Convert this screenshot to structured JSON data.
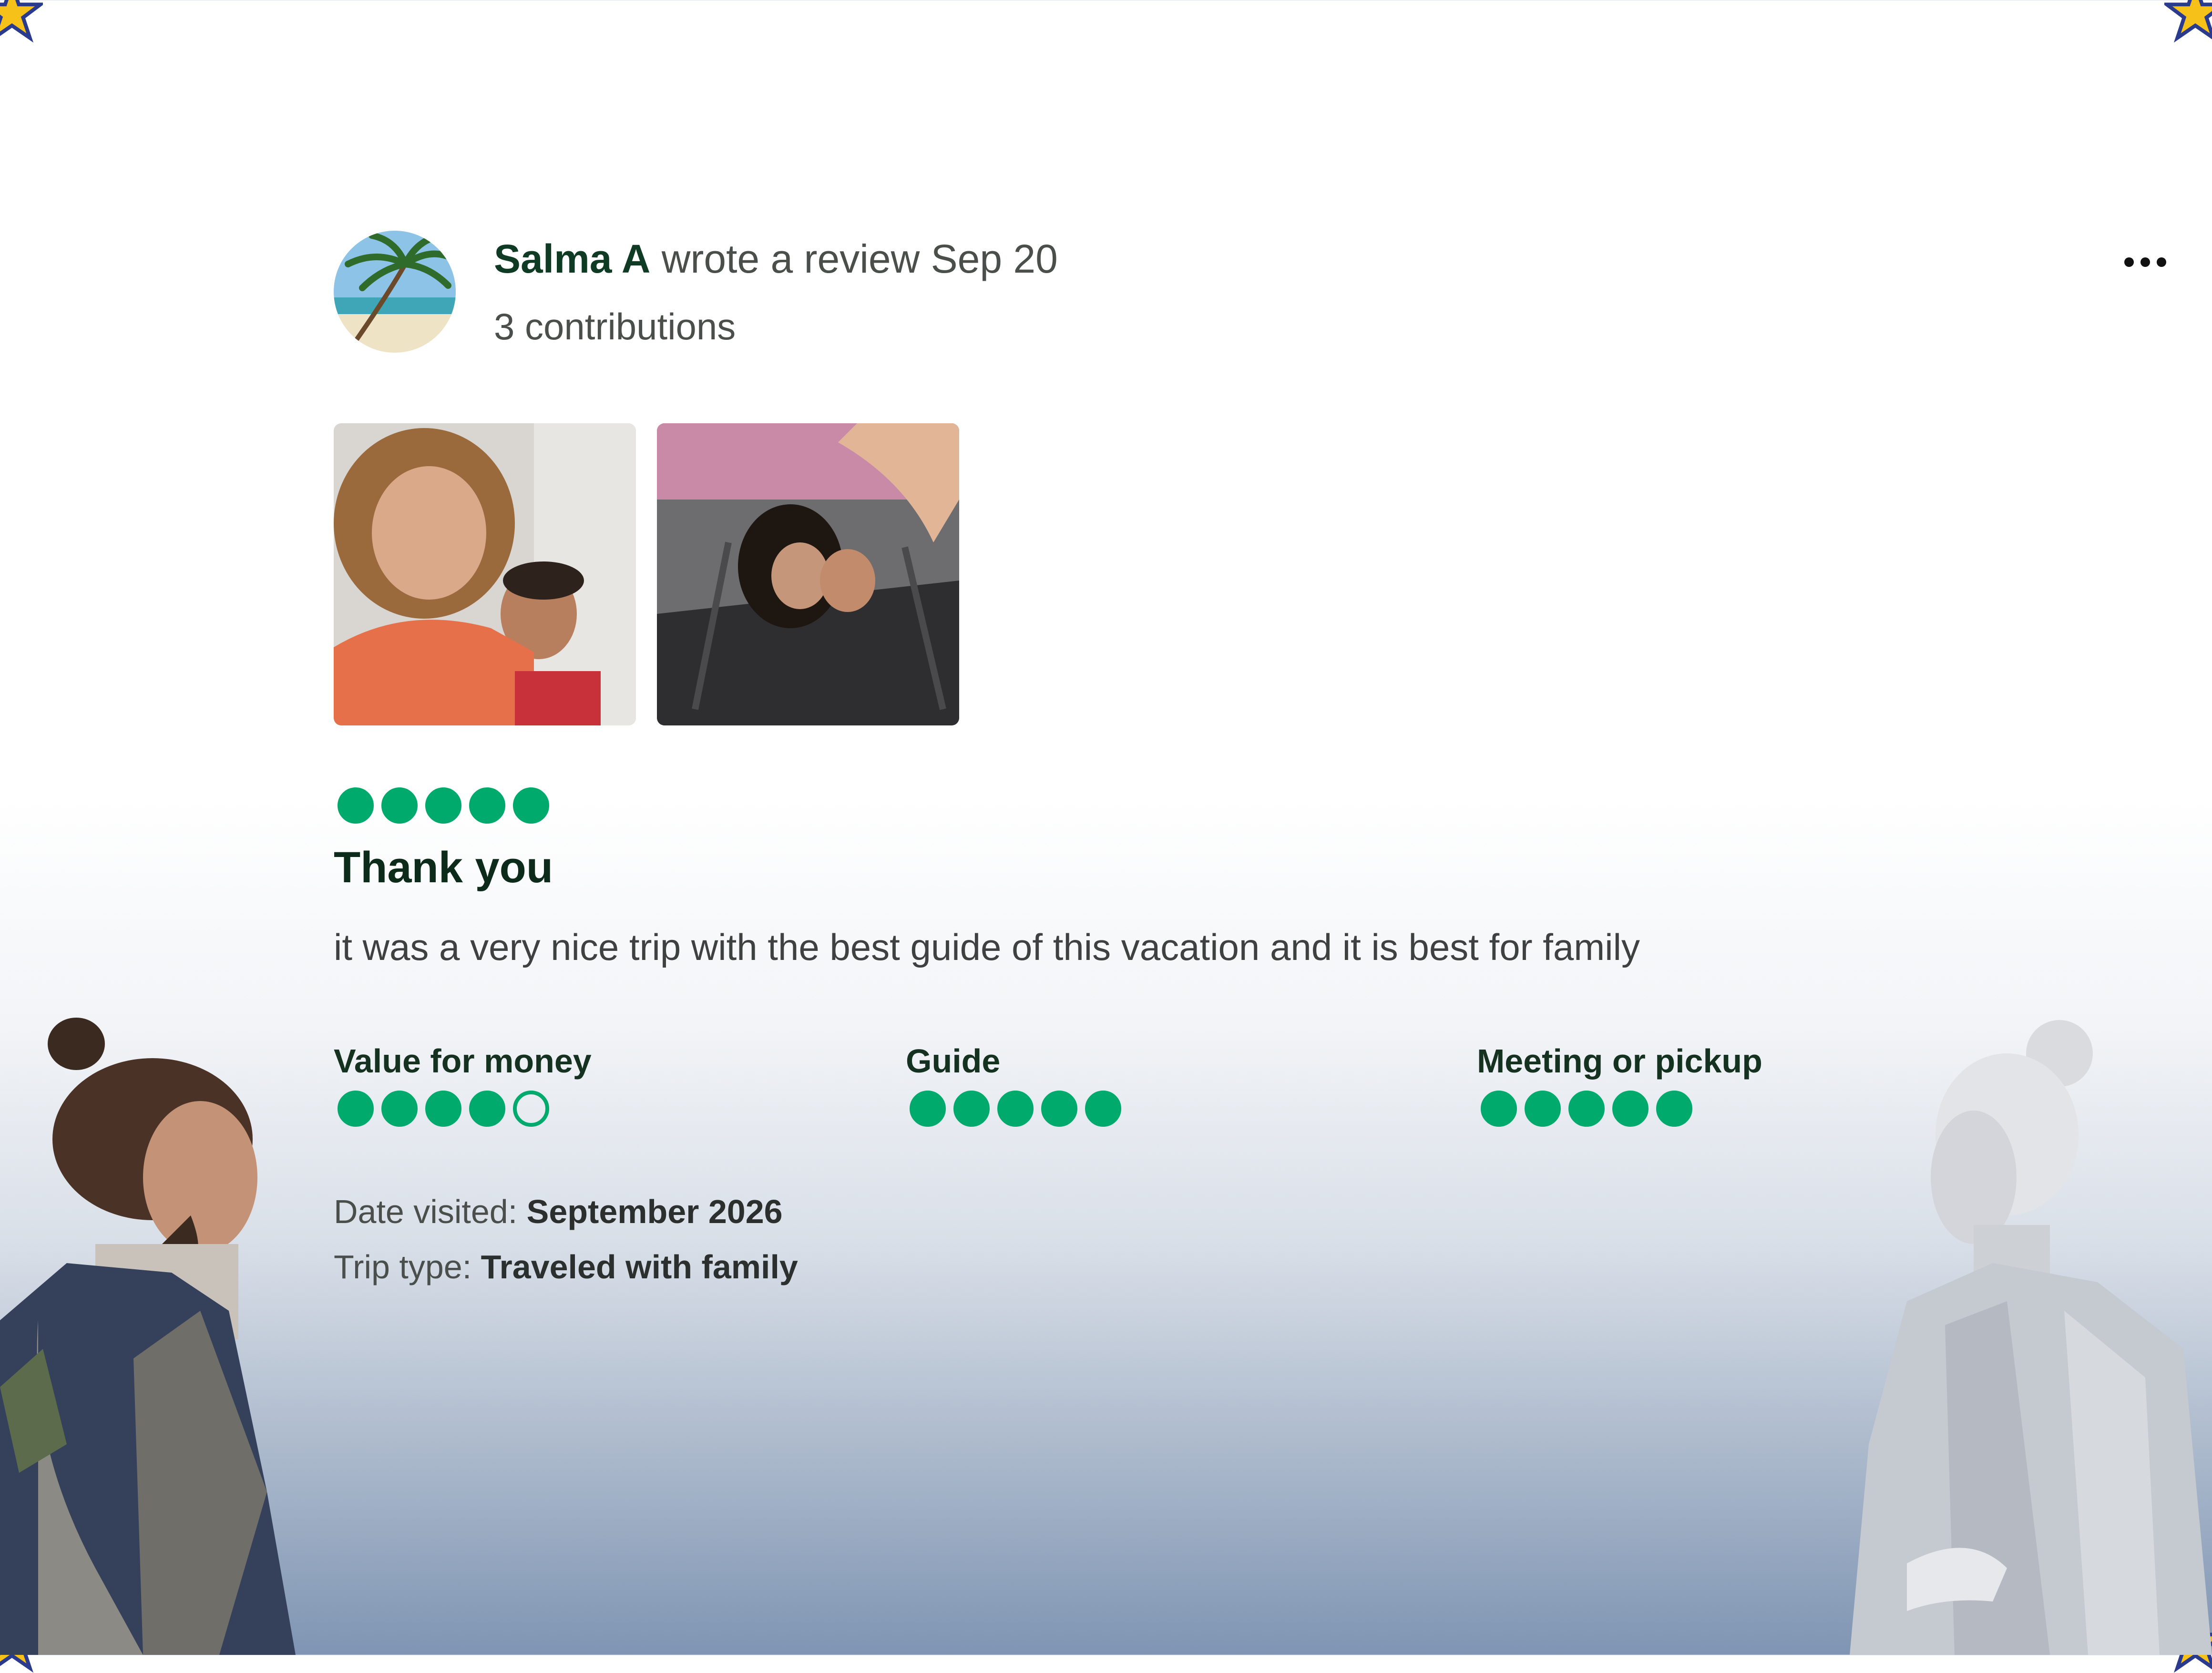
{
  "review": {
    "author": "Salma A",
    "action": "wrote a review Sep 20",
    "contributions": "3 contributions",
    "overall_rating": 5,
    "title": "Thank you",
    "body": "it was a very nice trip with the best guide of this vacation and it is best for family",
    "photos": [
      "selfie-photo",
      "group-selfie-photo"
    ]
  },
  "subratings": [
    {
      "label": "Value for money",
      "rating": 4
    },
    {
      "label": "Guide",
      "rating": 5
    },
    {
      "label": "Meeting or pickup",
      "rating": 5
    }
  ],
  "meta": {
    "date_label": "Date visited:",
    "date_value": "September 2026",
    "trip_label": "Trip type:",
    "trip_value": "Traveled with family"
  },
  "icons": {
    "menu": "more-options-icon",
    "rating": "bubble-rating-icon",
    "corner": "star-icon"
  },
  "colors": {
    "rating_green": "#00aa6c",
    "author_green": "#0f3b25"
  }
}
